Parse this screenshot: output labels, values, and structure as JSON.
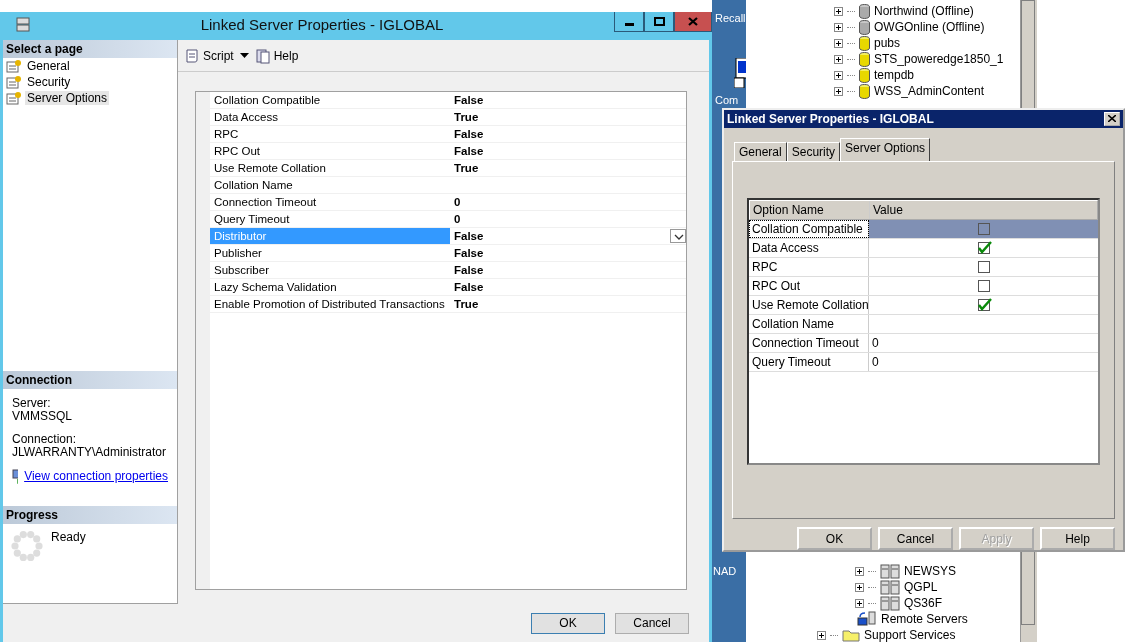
{
  "desktop": {
    "icons": [
      {
        "label": "Recall"
      },
      {
        "label": "Com"
      },
      {
        "label": "NAD"
      }
    ]
  },
  "object_tree": {
    "upper_items": [
      {
        "label": "Northwind (Offline)",
        "kind": "db-offline",
        "expandable": true
      },
      {
        "label": "OWGOnline (Offline)",
        "kind": "db-offline",
        "expandable": true
      },
      {
        "label": "pubs",
        "kind": "db",
        "expandable": true
      },
      {
        "label": "STS_poweredge1850_1",
        "kind": "db",
        "expandable": true
      },
      {
        "label": "tempdb",
        "kind": "db",
        "expandable": true
      },
      {
        "label": "WSS_AdminContent",
        "kind": "db",
        "expandable": true
      }
    ],
    "lower_items": [
      {
        "label": "NEWSYS",
        "kind": "servers",
        "expandable": true
      },
      {
        "label": "QGPL",
        "kind": "servers",
        "expandable": true
      },
      {
        "label": "QS36F",
        "kind": "servers",
        "expandable": true
      },
      {
        "label": "Remote Servers",
        "kind": "remote",
        "expandable": false
      },
      {
        "label": "Support Services",
        "kind": "folder",
        "expandable": true
      }
    ]
  },
  "main_dialog": {
    "title": "Linked Server Properties - IGLOBAL",
    "select_page_heading": "Select a page",
    "pages": [
      {
        "label": "General",
        "selected": false
      },
      {
        "label": "Security",
        "selected": false
      },
      {
        "label": "Server Options",
        "selected": true
      }
    ],
    "toolbar": {
      "script": "Script",
      "help": "Help"
    },
    "properties": [
      {
        "name": "Collation Compatible",
        "value": "False",
        "selected": false
      },
      {
        "name": "Data Access",
        "value": "True",
        "selected": false
      },
      {
        "name": "RPC",
        "value": "False",
        "selected": false
      },
      {
        "name": "RPC Out",
        "value": "False",
        "selected": false
      },
      {
        "name": "Use Remote Collation",
        "value": "True",
        "selected": false
      },
      {
        "name": "Collation Name",
        "selected": false
      },
      {
        "name": "Connection Timeout",
        "value": "0",
        "selected": false
      },
      {
        "name": "Query Timeout",
        "value": "0",
        "selected": false
      },
      {
        "name": "Distributor",
        "value": "False",
        "selected": true
      },
      {
        "name": "Publisher",
        "value": "False",
        "selected": false
      },
      {
        "name": "Subscriber",
        "value": "False",
        "selected": false
      },
      {
        "name": "Lazy Schema Validation",
        "value": "False",
        "selected": false
      },
      {
        "name": "Enable Promotion of Distributed Transactions",
        "value": "True",
        "selected": false
      }
    ],
    "connection": {
      "heading": "Connection",
      "server_label": "Server:",
      "server": "VMMSSQL",
      "connection_label": "Connection:",
      "connection": "JLWARRANTY\\Administrator",
      "link": "View connection properties"
    },
    "progress": {
      "heading": "Progress",
      "status": "Ready"
    },
    "buttons": [
      {
        "label": "OK",
        "default": true
      },
      {
        "label": "Cancel",
        "default": false
      }
    ]
  },
  "legacy_dialog": {
    "title": "Linked Server Properties - IGLOBAL",
    "tabs": [
      {
        "label": "General",
        "selected": false
      },
      {
        "label": "Security",
        "selected": false
      },
      {
        "label": "Server Options",
        "selected": true
      }
    ],
    "columns": [
      "Option Name",
      "Value"
    ],
    "options": [
      {
        "name": "Collation Compatible",
        "kind": "checkbox",
        "checked": false,
        "selected": true
      },
      {
        "name": "Data Access",
        "kind": "checkbox",
        "checked": true,
        "selected": false
      },
      {
        "name": "RPC",
        "kind": "checkbox",
        "checked": false,
        "selected": false
      },
      {
        "name": "RPC Out",
        "kind": "checkbox",
        "checked": false,
        "selected": false
      },
      {
        "name": "Use Remote Collation",
        "kind": "checkbox",
        "checked": true,
        "selected": false
      },
      {
        "name": "Collation Name",
        "kind": "text",
        "selected": false
      },
      {
        "name": "Connection Timeout",
        "kind": "text",
        "value": "0",
        "selected": false
      },
      {
        "name": "Query Timeout",
        "kind": "text",
        "value": "0",
        "selected": false
      }
    ],
    "buttons": [
      {
        "label": "OK",
        "disabled": false
      },
      {
        "label": "Cancel",
        "disabled": false
      },
      {
        "label": "Apply",
        "disabled": true
      },
      {
        "label": "Help",
        "disabled": false
      }
    ]
  }
}
